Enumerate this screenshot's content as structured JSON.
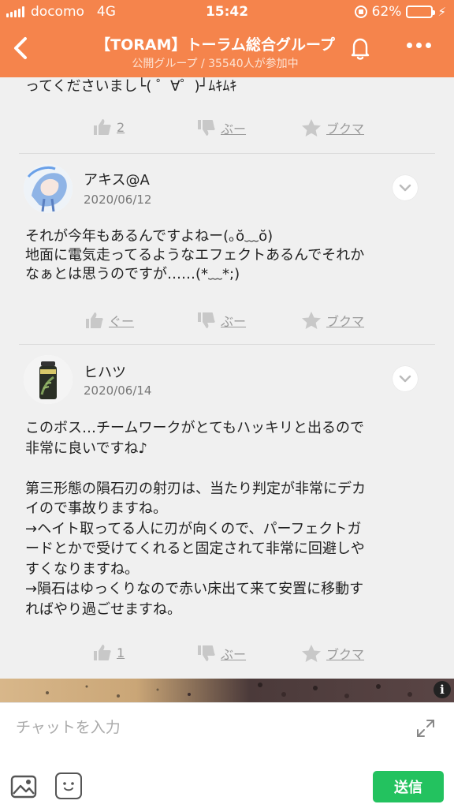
{
  "status_bar": {
    "carrier": "docomo",
    "network": "4G",
    "time": "15:42",
    "battery_percent": "62%",
    "battery_level": 0.62
  },
  "header": {
    "title": "【TORAM】トーラム総合グループ",
    "subtitle": "公開グループ / 35540人が参加中"
  },
  "posts": [
    {
      "text": "ってくださいまし└( ゜∀゜)┘ﾑｷﾑｷ",
      "like_label": "2",
      "dislike_label": "ぶー",
      "bookmark_label": "ブクマ"
    },
    {
      "username": "アキス@A",
      "date": "2020/06/12",
      "text": "それが今年もあるんですよねー(｡ŏ﹏ŏ)\n地面に電気走ってるようなエフェクトあるんでそれか\nなぁとは思うのですが……(*﹏*;)",
      "like_label": "ぐー",
      "dislike_label": "ぶー",
      "bookmark_label": "ブクマ"
    },
    {
      "username": "ヒハツ",
      "date": "2020/06/14",
      "text": "このボス…チームワークがとてもハッキリと出るので\n非常に良いですね♪\n\n第三形態の隕石刃の射刃は、当たり判定が非常にデカ\nイので事故りますね。\n→ヘイト取ってる人に刃が向くので、パーフェクトガ\nードとかで受けてくれると固定されて非常に回避しや\nすくなりますね。\n→隕石はゆっくりなので赤い床出て来て安置に移動す\nればやり過ごせますね。",
      "like_label": "1",
      "dislike_label": "ぶー",
      "bookmark_label": "ブクマ"
    }
  ],
  "banner": {
    "info_label": "i"
  },
  "composer": {
    "placeholder": "チャットを入力",
    "send_label": "送信"
  },
  "colors": {
    "header_bg": "#f5844c",
    "send_bg": "#23c25f",
    "action_gray": "#9a9a9a"
  }
}
